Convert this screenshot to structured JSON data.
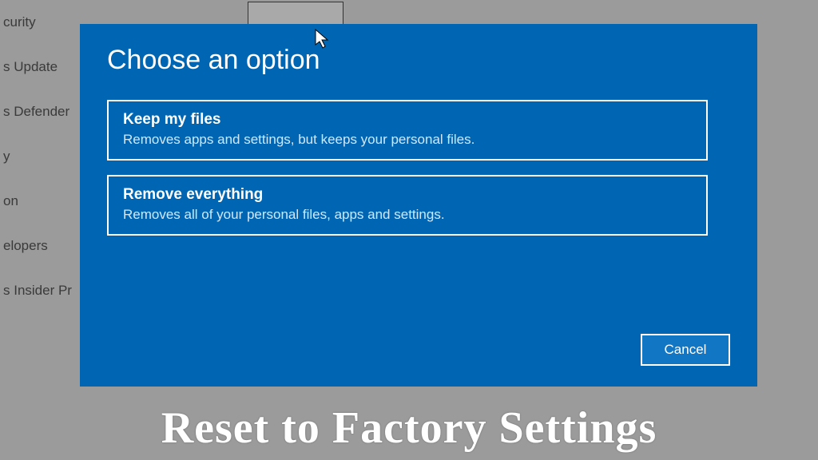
{
  "sidebar": {
    "items": [
      {
        "label": "curity"
      },
      {
        "label": "s Update"
      },
      {
        "label": "s Defender"
      },
      {
        "label": "y"
      },
      {
        "label": "on"
      },
      {
        "label": "elopers"
      },
      {
        "label": "s Insider Pr"
      }
    ]
  },
  "dialog": {
    "title": "Choose an option",
    "options": [
      {
        "title": "Keep my files",
        "description": "Removes apps and settings, but keeps your personal files."
      },
      {
        "title": "Remove everything",
        "description": "Removes all of your personal files, apps and settings."
      }
    ],
    "cancel_label": "Cancel"
  },
  "caption": "Reset to Factory Settings"
}
